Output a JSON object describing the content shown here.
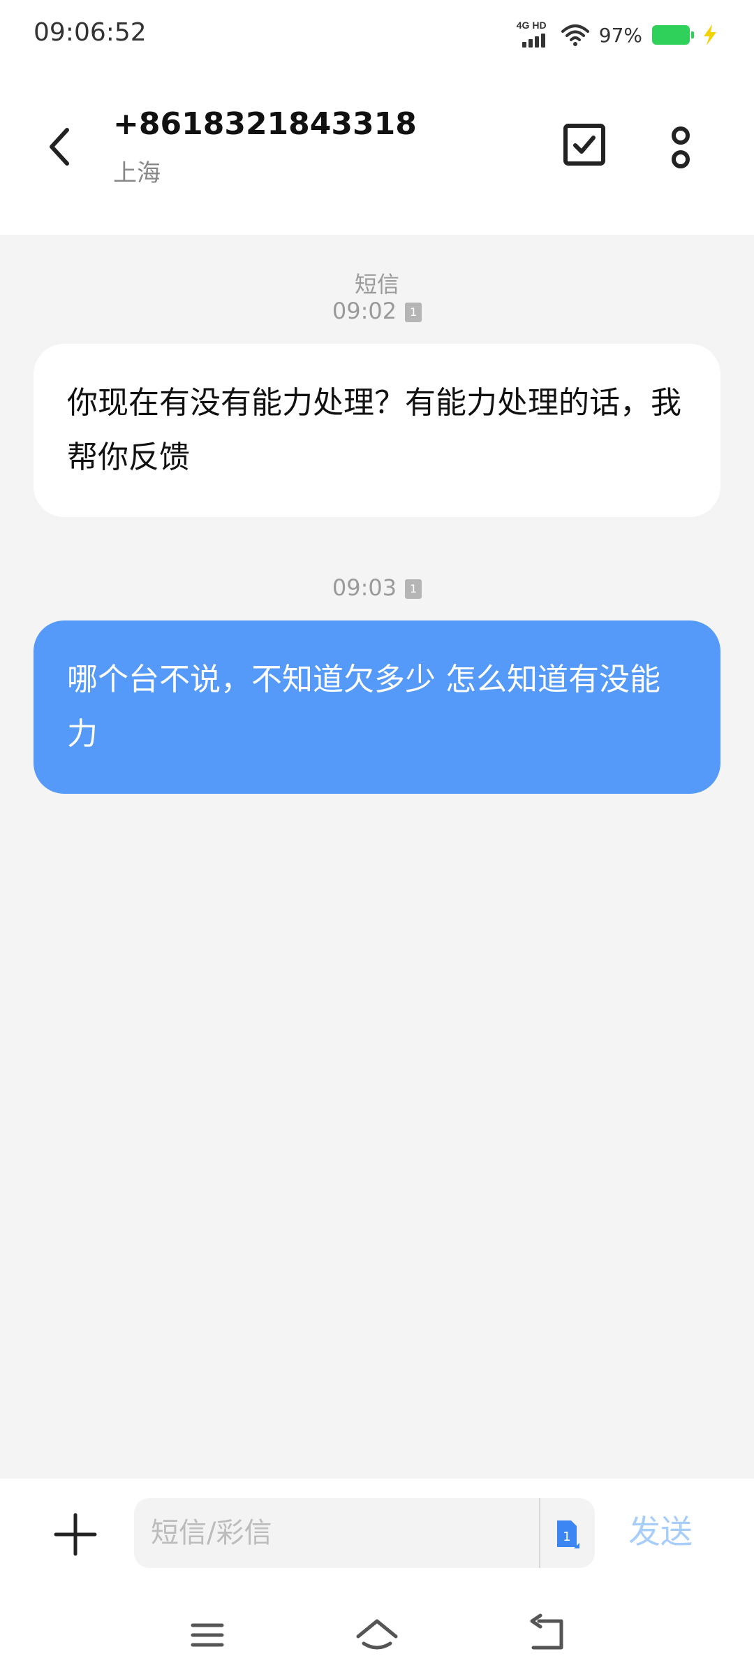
{
  "status_bar": {
    "time": "09:06:52",
    "network": "4G HD",
    "battery_percent": "97%",
    "battery_level": 0.97,
    "battery_color": "#2fd15a",
    "icons": [
      "signal-icon",
      "wifi-icon",
      "battery-icon",
      "charging-icon"
    ]
  },
  "header": {
    "contact_number": "+8618321843318",
    "contact_location": "上海",
    "icons": [
      "back-arrow-icon",
      "select-checkbox-icon",
      "more-options-icon"
    ]
  },
  "messages": [
    {
      "direction": "incoming",
      "label": "短信",
      "time": "09:02",
      "sim": "1",
      "text": "你现在有没有能力处理？有能力处理的话，我帮你反馈"
    },
    {
      "direction": "outgoing",
      "time": "09:03",
      "sim": "1",
      "text": "哪个台不说，不知道欠多少 怎么知道有没能力"
    }
  ],
  "compose": {
    "placeholder": "短信/彩信",
    "sim": "1",
    "send_label": "发送",
    "icons": [
      "add-attachment-icon",
      "sim-card-icon"
    ]
  },
  "colors": {
    "outgoing_bubble": "#559af8",
    "incoming_bubble": "#ffffff",
    "chat_background": "#f4f4f4",
    "send_disabled": "#a7cdfb"
  },
  "nav_bar": {
    "icons": [
      "menu-icon",
      "home-icon",
      "back-icon"
    ]
  }
}
